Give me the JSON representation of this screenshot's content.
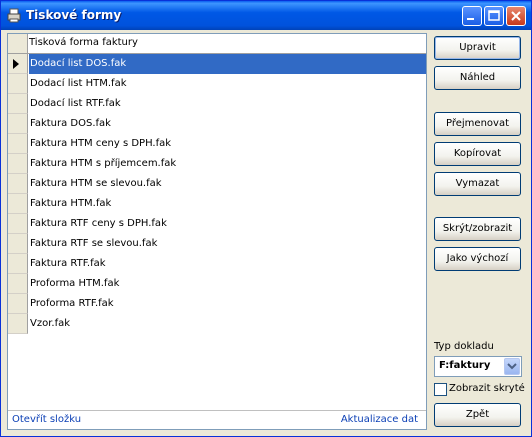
{
  "window": {
    "title": "Tiskové formy",
    "title_color": "#0058e6"
  },
  "grid": {
    "column_header": "Tisková forma faktury",
    "rows": [
      {
        "label": "Dodací list DOS.fak",
        "selected": true
      },
      {
        "label": "Dodací list HTM.fak"
      },
      {
        "label": "Dodací list RTF.fak"
      },
      {
        "label": "Faktura DOS.fak"
      },
      {
        "label": "Faktura HTM ceny s DPH.fak"
      },
      {
        "label": "Faktura HTM s příjemcem.fak"
      },
      {
        "label": "Faktura HTM se slevou.fak"
      },
      {
        "label": "Faktura HTM.fak"
      },
      {
        "label": "Faktura RTF ceny s DPH.fak"
      },
      {
        "label": "Faktura RTF se slevou.fak"
      },
      {
        "label": "Faktura RTF.fak"
      },
      {
        "label": "Proforma HTM.fak"
      },
      {
        "label": "Proforma RTF.fak"
      },
      {
        "label": "Vzor.fak"
      }
    ],
    "selection_color": "#316ac5"
  },
  "footer": {
    "open_folder": "Otevřít složku",
    "refresh": "Aktualizace dat"
  },
  "buttons": {
    "edit": "Upravit",
    "preview": "Náhled",
    "rename": "Přejmenovat",
    "copy": "Kopírovat",
    "delete": "Vymazat",
    "hide_show": "Skrýt/zobrazit",
    "as_default": "Jako výchozí",
    "back": "Zpět"
  },
  "doc_type": {
    "label": "Typ dokladu",
    "selected": "F:faktury"
  },
  "show_hidden": {
    "label": "Zobrazit skryté",
    "checked": false
  }
}
